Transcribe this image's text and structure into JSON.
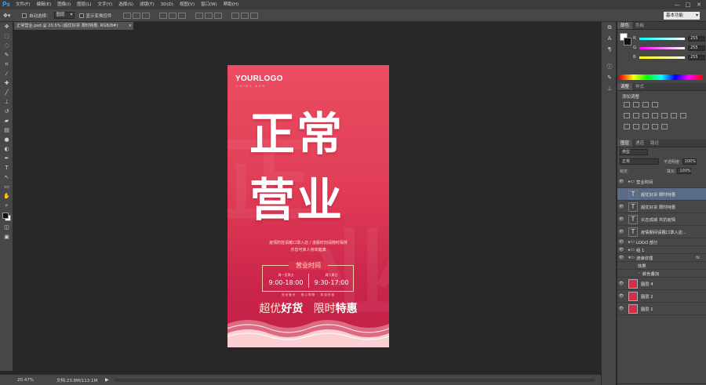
{
  "app": {
    "logo": "Ps"
  },
  "menu": [
    "文件(F)",
    "编辑(E)",
    "图像(I)",
    "图层(L)",
    "文字(Y)",
    "选择(S)",
    "滤镜(T)",
    "3D(D)",
    "视图(V)",
    "窗口(W)",
    "帮助(H)"
  ],
  "window_controls": [
    "—",
    "□",
    "✕"
  ],
  "options": {
    "tool_icon": "move-tool-icon",
    "auto_select_label": "自动选择：",
    "auto_select_value": "图层",
    "show_transform_label": "显示变换控件",
    "workspace": "基本功能"
  },
  "document": {
    "tab_title": "正常营业.psd @ 20.5% (超优好货  限时特惠, RGB/8#)",
    "close": "×"
  },
  "poster": {
    "logo": "YOURLOGO",
    "logo_sub": "CHINA BAR",
    "headline_1": "正常",
    "headline_2": "营业",
    "notice_1": "疫情防控请戴口罩入店 / 凌晨时刻请随时保持",
    "notice_2": "乐您可家人身体健康",
    "hours_title": "营业时间",
    "hours": [
      {
        "day": "周一至周五",
        "time": "9:00-18:00"
      },
      {
        "day": "周六周日",
        "time": "9:30-17:00"
      }
    ],
    "subline": "安全营业 · 放心购物 · 欢迎光临",
    "slogan_a": "超优",
    "slogan_a_bold": "好货",
    "slogan_b": "限时",
    "slogan_b_bold": "特惠"
  },
  "status": {
    "zoom": "20.47%",
    "doc_info": "文档:23.8M/113.1M"
  },
  "color_panel": {
    "tabs": [
      "颜色",
      "色板"
    ],
    "rows": [
      {
        "label": "R",
        "value": "255"
      },
      {
        "label": "G",
        "value": "255"
      },
      {
        "label": "B",
        "value": "255"
      }
    ]
  },
  "adjust_panel": {
    "tabs": [
      "调整",
      "样式"
    ],
    "title": "添加调整"
  },
  "layers_panel": {
    "tabs": [
      "图层",
      "通道",
      "路径"
    ],
    "filter_label": "类型",
    "blend_mode": "正常",
    "opacity_label": "不透明度:",
    "opacity": "100%",
    "lock_label": "锁定:",
    "fill_label": "填充:",
    "fill": "100%",
    "layers": [
      {
        "kind": "group",
        "name": "营业时间",
        "eye": "👁"
      },
      {
        "kind": "text",
        "name": "超优好货  限时特惠",
        "eye": "",
        "selected": true
      },
      {
        "kind": "text",
        "name": "超优好货  限时特惠",
        "eye": "👁"
      },
      {
        "kind": "text",
        "name": "众志成城 共抗疫情",
        "eye": "👁"
      },
      {
        "kind": "text",
        "name": "疫情期间请戴口罩入店...",
        "eye": "👁"
      },
      {
        "kind": "group",
        "name": "LOGO 部分",
        "eye": "👁"
      },
      {
        "kind": "group",
        "name": "组 1",
        "eye": "👁"
      },
      {
        "kind": "group",
        "name": "波浪纹理",
        "eye": "👁",
        "fx": "fx"
      },
      {
        "kind": "effect",
        "name": "效果"
      },
      {
        "kind": "effect2",
        "name": "颜色叠加"
      },
      {
        "kind": "image",
        "name": "图层 4",
        "eye": "👁"
      },
      {
        "kind": "image",
        "name": "图层 2",
        "eye": "👁"
      },
      {
        "kind": "image",
        "name": "图层 1",
        "eye": "👁"
      }
    ]
  },
  "colors": {
    "poster_top": "#ec4d62",
    "poster_bottom": "#c22046",
    "selection": "#5a6b87",
    "ps_blue": "#31a8ff"
  }
}
